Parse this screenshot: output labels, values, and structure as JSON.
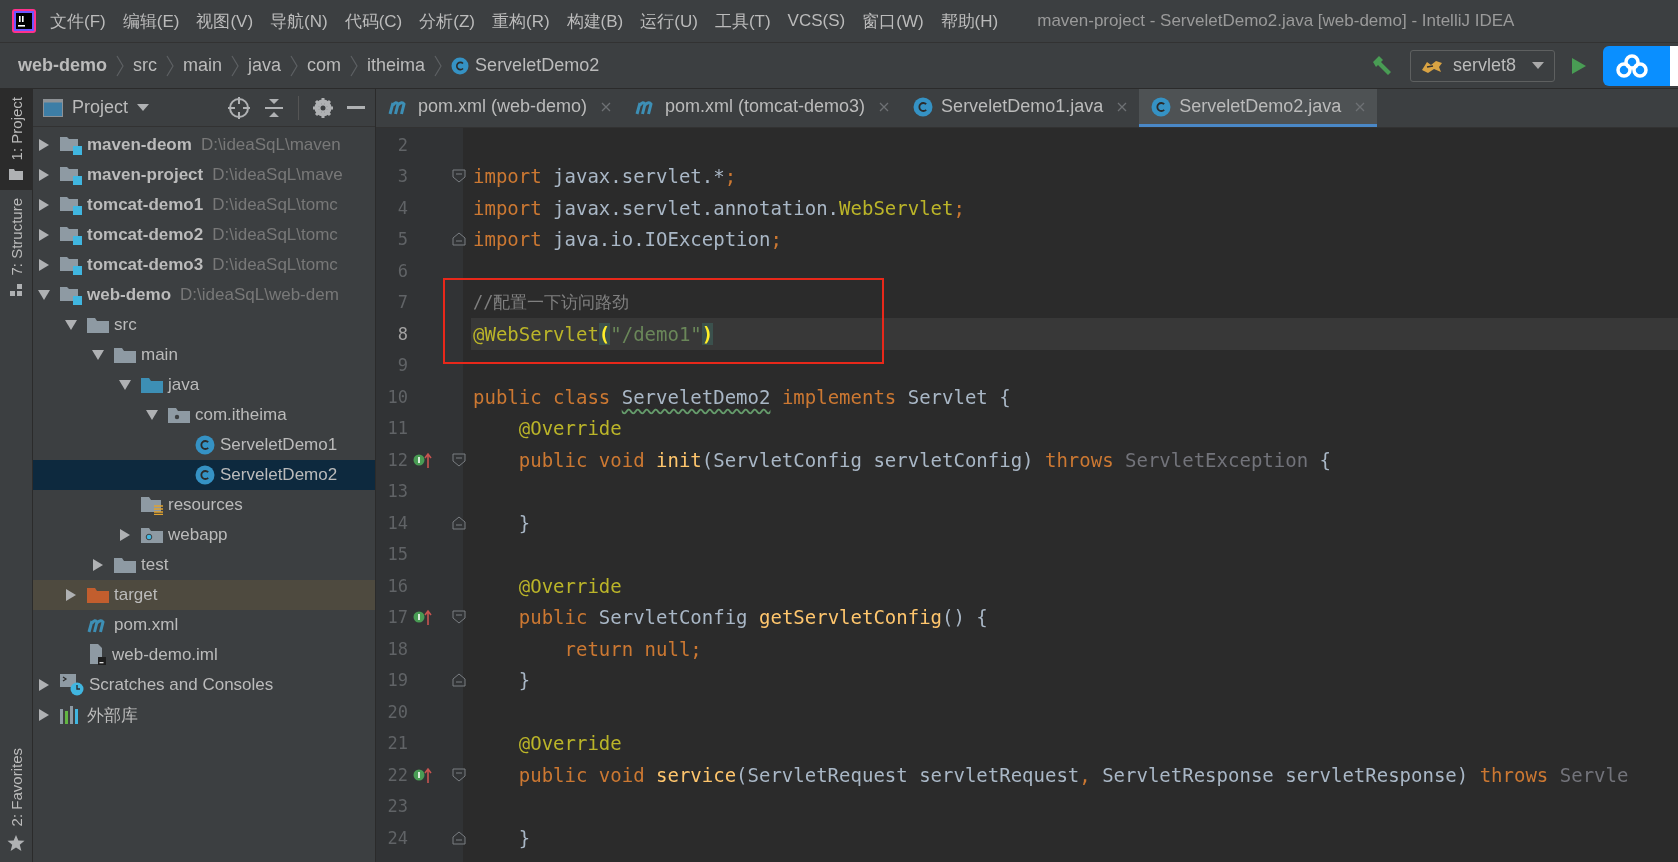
{
  "menu": [
    {
      "label": "文件(F)"
    },
    {
      "label": "编辑(E)"
    },
    {
      "label": "视图(V)"
    },
    {
      "label": "导航(N)"
    },
    {
      "label": "代码(C)"
    },
    {
      "label": "分析(Z)"
    },
    {
      "label": "重构(R)"
    },
    {
      "label": "构建(B)"
    },
    {
      "label": "运行(U)"
    },
    {
      "label": "工具(T)"
    },
    {
      "label": "VCS(S)"
    },
    {
      "label": "窗口(W)"
    },
    {
      "label": "帮助(H)"
    }
  ],
  "window_title": "maven-project - ServeletDemo2.java [web-demo] - IntelliJ IDEA",
  "breadcrumb": [
    {
      "label": "web-demo",
      "kind": "module"
    },
    {
      "label": "src",
      "kind": "dir"
    },
    {
      "label": "main",
      "kind": "dir"
    },
    {
      "label": "java",
      "kind": "dir"
    },
    {
      "label": "com",
      "kind": "dir"
    },
    {
      "label": "itheima",
      "kind": "dir"
    },
    {
      "label": "ServeletDemo2",
      "kind": "class"
    }
  ],
  "run_config": {
    "label": "servlet8"
  },
  "tool_stripe_top": [
    {
      "label": "1: Project",
      "kind": "project",
      "selected": true
    },
    {
      "label": "7: Structure",
      "kind": "structure",
      "selected": false
    }
  ],
  "tool_stripe_bottom": [
    {
      "label": "2: Favorites",
      "kind": "favorites",
      "selected": false
    }
  ],
  "project_panel": {
    "title": "Project",
    "tree": [
      {
        "label": "maven-deom",
        "path": "D:\\ideaSqL\\maven",
        "kind": "module",
        "expanded": false,
        "selected": false,
        "highlighted": false
      },
      {
        "label": "maven-project",
        "path": "D:\\ideaSqL\\mave",
        "kind": "module",
        "expanded": false,
        "selected": false,
        "highlighted": false
      },
      {
        "label": "tomcat-demo1",
        "path": "D:\\ideaSqL\\tomc",
        "kind": "module",
        "expanded": false,
        "selected": false,
        "highlighted": false
      },
      {
        "label": "tomcat-demo2",
        "path": "D:\\ideaSqL\\tomc",
        "kind": "module",
        "expanded": false,
        "selected": false,
        "highlighted": false
      },
      {
        "label": "tomcat-demo3",
        "path": "D:\\ideaSqL\\tomc",
        "kind": "module",
        "expanded": false,
        "selected": false,
        "highlighted": false
      },
      {
        "label": "web-demo",
        "path": "D:\\ideaSqL\\web-dem",
        "kind": "module",
        "expanded": true,
        "selected": false,
        "highlighted": false,
        "children": [
          {
            "label": "src",
            "kind": "folder",
            "expanded": true,
            "selected": false,
            "highlighted": false,
            "children": [
              {
                "label": "main",
                "kind": "folder",
                "expanded": true,
                "selected": false,
                "highlighted": false,
                "children": [
                  {
                    "label": "java",
                    "kind": "source-folder",
                    "expanded": true,
                    "selected": false,
                    "highlighted": false,
                    "children": [
                      {
                        "label": "com.itheima",
                        "kind": "package",
                        "expanded": true,
                        "selected": false,
                        "highlighted": false,
                        "children": [
                          {
                            "label": "ServeletDemo1",
                            "kind": "class",
                            "selected": false,
                            "highlighted": false
                          },
                          {
                            "label": "ServeletDemo2",
                            "kind": "class",
                            "selected": true,
                            "highlighted": false
                          }
                        ]
                      }
                    ]
                  },
                  {
                    "label": "resources",
                    "kind": "resources-folder",
                    "selected": false,
                    "highlighted": false
                  },
                  {
                    "label": "webapp",
                    "kind": "web-folder",
                    "expanded": false,
                    "selected": false,
                    "highlighted": false
                  }
                ]
              },
              {
                "label": "test",
                "kind": "folder",
                "expanded": false,
                "selected": false,
                "highlighted": false
              }
            ]
          },
          {
            "label": "target",
            "kind": "excluded-folder",
            "expanded": false,
            "selected": false,
            "highlighted": true
          },
          {
            "label": "pom.xml",
            "kind": "maven",
            "selected": false,
            "highlighted": false
          },
          {
            "label": "web-demo.iml",
            "kind": "iml",
            "selected": false,
            "highlighted": false
          }
        ]
      },
      {
        "label": "Scratches and Consoles",
        "kind": "scratches",
        "expanded": false,
        "selected": false,
        "highlighted": false
      },
      {
        "label": "外部库",
        "kind": "libraries",
        "expanded": false,
        "selected": false,
        "highlighted": false
      }
    ]
  },
  "editor": {
    "tabs": [
      {
        "label": "pom.xml (web-demo)",
        "kind": "maven",
        "selected": false
      },
      {
        "label": "pom.xml (tomcat-demo3)",
        "kind": "maven",
        "selected": false
      },
      {
        "label": "ServeletDemo1.java",
        "kind": "class",
        "selected": false
      },
      {
        "label": "ServeletDemo2.java",
        "kind": "class",
        "selected": true
      }
    ],
    "lines": [
      {
        "number": "2",
        "current": false,
        "boxed": false
      },
      {
        "number": "3",
        "current": false,
        "boxed": false,
        "gutter": [
          {
            "kind": "fold-start"
          }
        ],
        "tokens": [
          {
            "kind": "keyword",
            "text": "import"
          },
          {
            "kind": "plain",
            "text": " javax.servlet.*"
          },
          {
            "kind": "keyword",
            "text": ";"
          }
        ]
      },
      {
        "number": "4",
        "current": false,
        "boxed": false,
        "tokens": [
          {
            "kind": "keyword",
            "text": "import"
          },
          {
            "kind": "plain",
            "text": " javax.servlet.annotation."
          },
          {
            "kind": "annotation",
            "text": "WebServlet"
          },
          {
            "kind": "keyword",
            "text": ";"
          }
        ]
      },
      {
        "number": "5",
        "current": false,
        "boxed": false,
        "gutter": [
          {
            "kind": "fold-end"
          }
        ],
        "tokens": [
          {
            "kind": "keyword",
            "text": "import"
          },
          {
            "kind": "plain",
            "text": " java.io.IOException"
          },
          {
            "kind": "keyword",
            "text": ";"
          }
        ]
      },
      {
        "number": "6",
        "current": false,
        "boxed": false
      },
      {
        "number": "7",
        "current": false,
        "boxed": true,
        "tokens": [
          {
            "kind": "comment",
            "text": "//配置一下访问路劲"
          }
        ]
      },
      {
        "number": "8",
        "current": true,
        "boxed": true,
        "tokens": [
          {
            "kind": "annotation",
            "text": "@WebServlet"
          },
          {
            "kind": "paren",
            "text": "("
          },
          {
            "kind": "string",
            "text": "\"/demo1\""
          },
          {
            "kind": "paren",
            "text": ")"
          }
        ]
      },
      {
        "number": "9",
        "current": false,
        "boxed": true
      },
      {
        "number": "10",
        "current": false,
        "boxed": false,
        "tokens": [
          {
            "kind": "keyword",
            "text": "public class "
          },
          {
            "kind": "typo",
            "text": "ServeletDemo2"
          },
          {
            "kind": "keyword",
            "text": " implements "
          },
          {
            "kind": "plain",
            "text": "Servlet {"
          }
        ]
      },
      {
        "number": "11",
        "current": false,
        "boxed": false,
        "tokens": [
          {
            "kind": "annotation",
            "text": "    @Override"
          }
        ]
      },
      {
        "number": "12",
        "current": false,
        "boxed": false,
        "gutter": [
          {
            "kind": "implements"
          },
          {
            "kind": "fold-start"
          }
        ],
        "tokens": [
          {
            "kind": "keyword",
            "text": "    public void "
          },
          {
            "kind": "method",
            "text": "init"
          },
          {
            "kind": "plain",
            "text": "(ServletConfig servletConfig) "
          },
          {
            "kind": "keyword",
            "text": "throws "
          },
          {
            "kind": "muted",
            "text": "ServletException"
          },
          {
            "kind": "plain",
            "text": " {"
          }
        ]
      },
      {
        "number": "13",
        "current": false,
        "boxed": false
      },
      {
        "number": "14",
        "current": false,
        "boxed": false,
        "gutter": [
          {
            "kind": "fold-end"
          }
        ],
        "tokens": [
          {
            "kind": "plain",
            "text": "    }"
          }
        ]
      },
      {
        "number": "15",
        "current": false,
        "boxed": false
      },
      {
        "number": "16",
        "current": false,
        "boxed": false,
        "tokens": [
          {
            "kind": "annotation",
            "text": "    @Override"
          }
        ]
      },
      {
        "number": "17",
        "current": false,
        "boxed": false,
        "gutter": [
          {
            "kind": "implements"
          },
          {
            "kind": "fold-start"
          }
        ],
        "tokens": [
          {
            "kind": "keyword",
            "text": "    public "
          },
          {
            "kind": "plain",
            "text": "ServletConfig "
          },
          {
            "kind": "method",
            "text": "getServletConfig"
          },
          {
            "kind": "plain",
            "text": "() {"
          }
        ]
      },
      {
        "number": "18",
        "current": false,
        "boxed": false,
        "tokens": [
          {
            "kind": "keyword",
            "text": "        return null;"
          }
        ]
      },
      {
        "number": "19",
        "current": false,
        "boxed": false,
        "gutter": [
          {
            "kind": "fold-end"
          }
        ],
        "tokens": [
          {
            "kind": "plain",
            "text": "    }"
          }
        ]
      },
      {
        "number": "20",
        "current": false,
        "boxed": false
      },
      {
        "number": "21",
        "current": false,
        "boxed": false,
        "tokens": [
          {
            "kind": "annotation",
            "text": "    @Override"
          }
        ]
      },
      {
        "number": "22",
        "current": false,
        "boxed": false,
        "gutter": [
          {
            "kind": "implements"
          },
          {
            "kind": "fold-start"
          }
        ],
        "tokens": [
          {
            "kind": "keyword",
            "text": "    public void "
          },
          {
            "kind": "method",
            "text": "service"
          },
          {
            "kind": "plain",
            "text": "(ServletRequest servletRequest"
          },
          {
            "kind": "keyword",
            "text": ", "
          },
          {
            "kind": "plain",
            "text": "ServletResponse servletResponse) "
          },
          {
            "kind": "keyword",
            "text": "throws "
          },
          {
            "kind": "muted",
            "text": "Servle"
          }
        ]
      },
      {
        "number": "23",
        "current": false,
        "boxed": false
      },
      {
        "number": "24",
        "current": false,
        "boxed": false,
        "gutter": [
          {
            "kind": "fold-end"
          }
        ],
        "tokens": [
          {
            "kind": "plain",
            "text": "    }"
          }
        ]
      }
    ]
  }
}
